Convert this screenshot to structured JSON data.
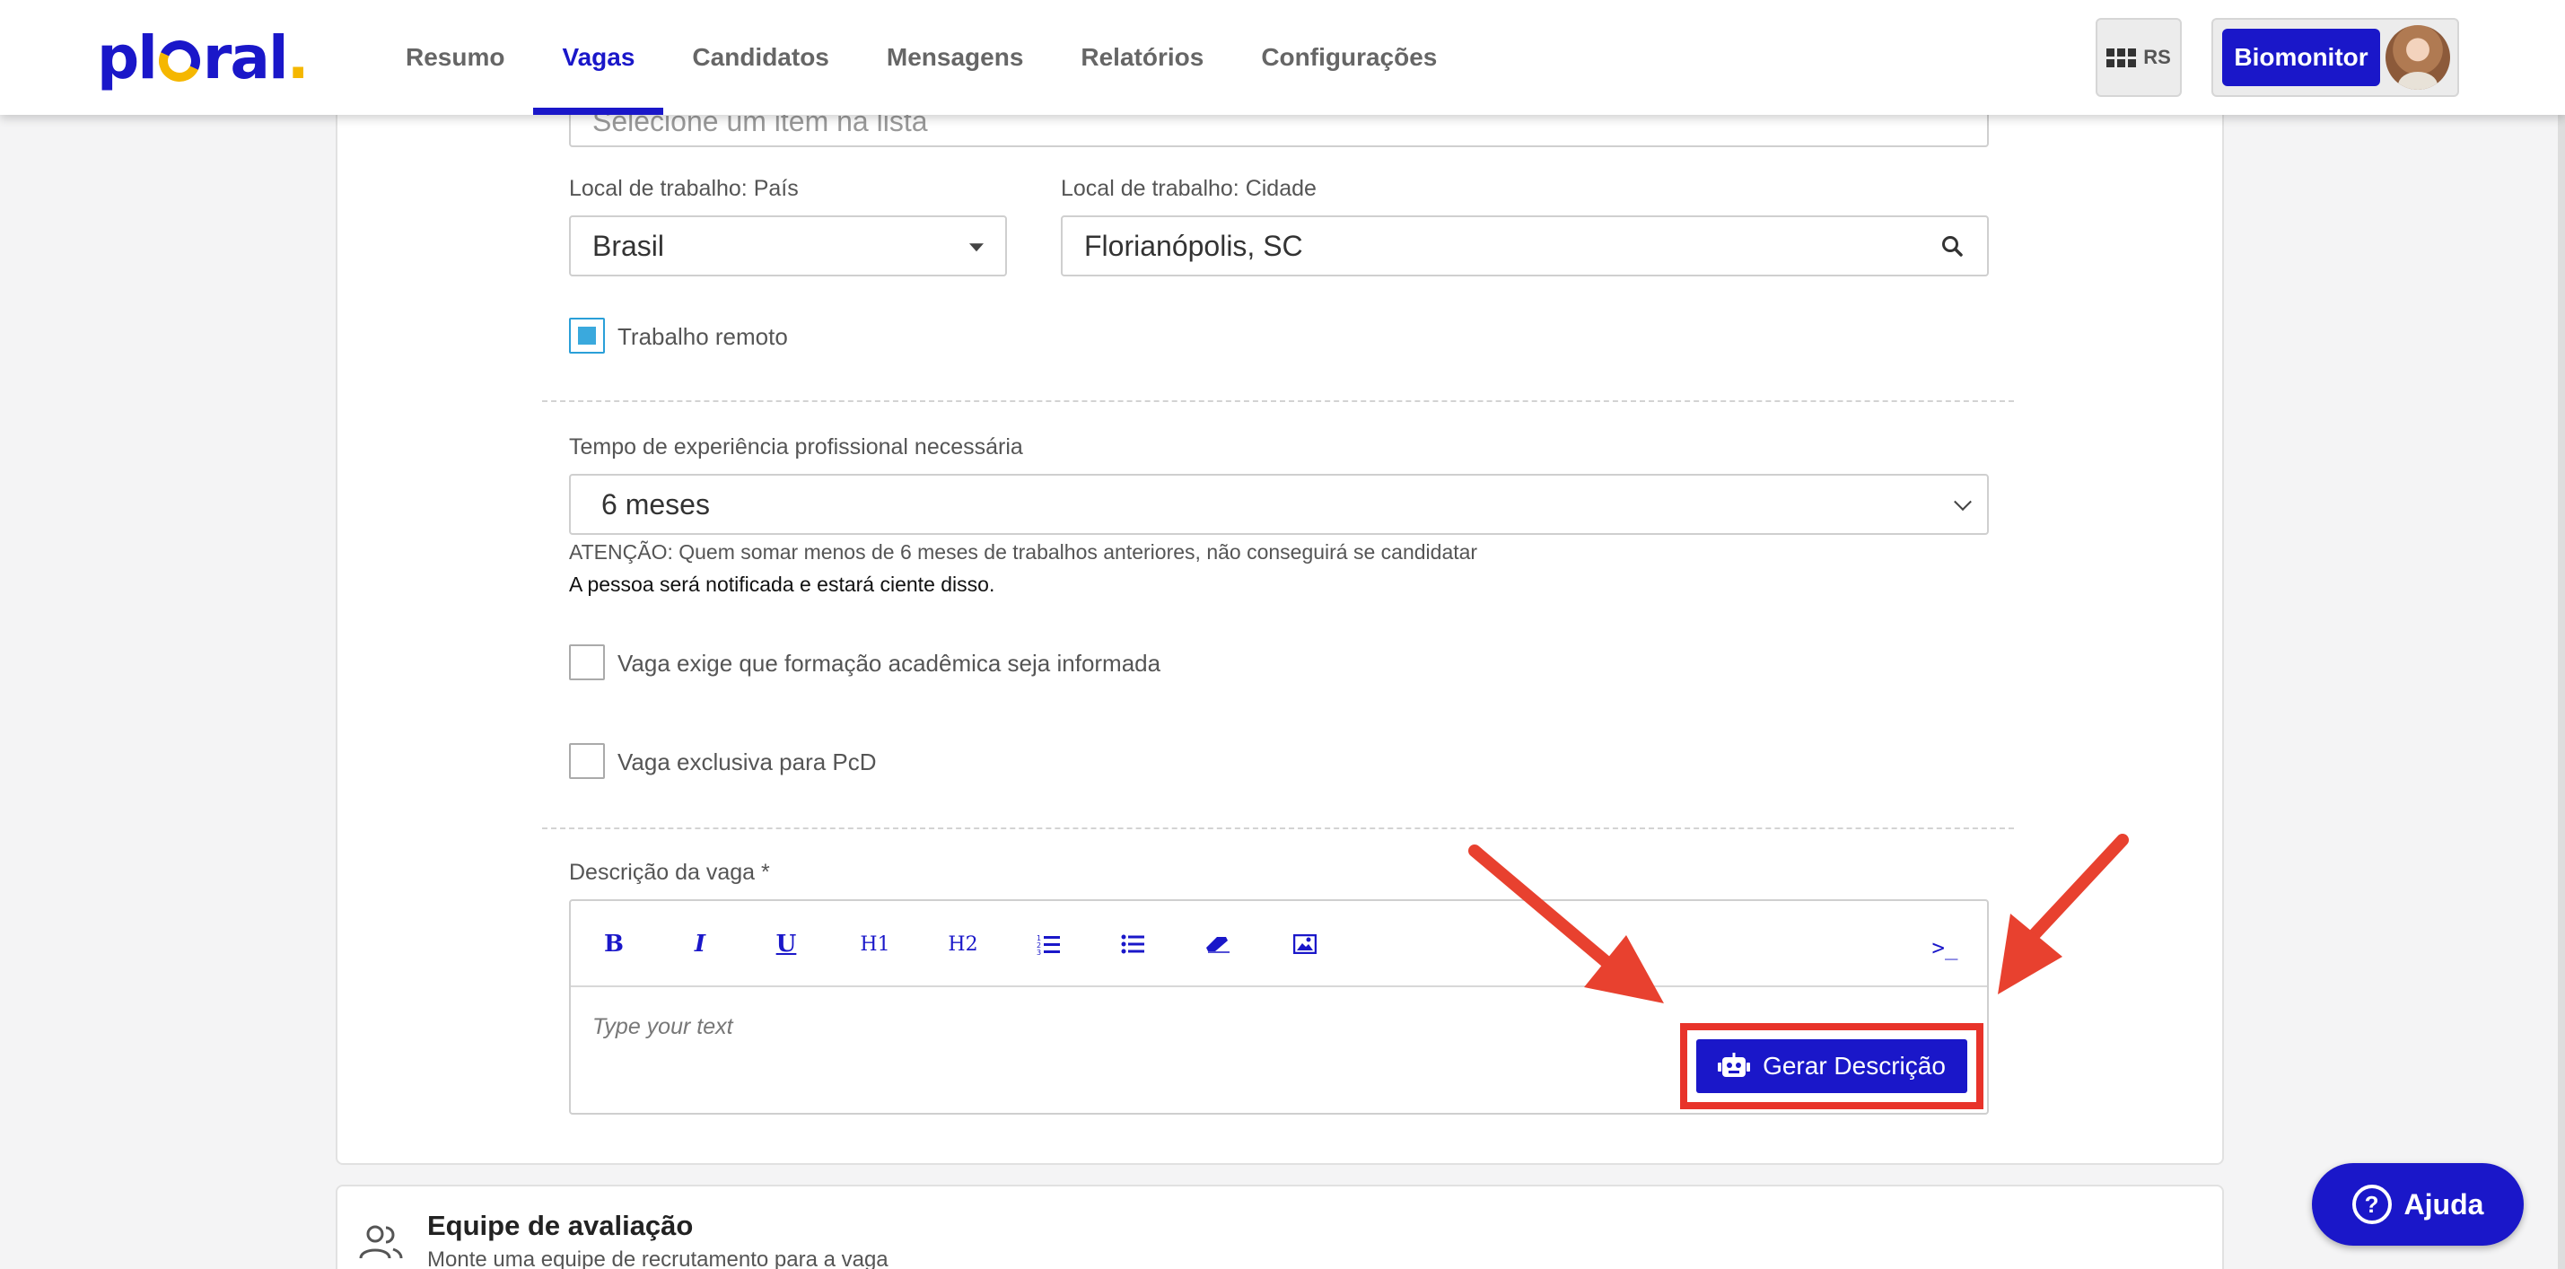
{
  "header": {
    "logo_text": "plural",
    "tabs": [
      {
        "label": "Resumo",
        "active": false
      },
      {
        "label": "Vagas",
        "active": true
      },
      {
        "label": "Candidatos",
        "active": false
      },
      {
        "label": "Mensagens",
        "active": false
      },
      {
        "label": "Relatórios",
        "active": false
      },
      {
        "label": "Configurações",
        "active": false
      }
    ],
    "apps_label": "RS",
    "company": "Biomonitor"
  },
  "form": {
    "top_select_placeholder": "Selecione um item na lista",
    "country_label": "Local de trabalho: País",
    "country_value": "Brasil",
    "city_label": "Local de trabalho: Cidade",
    "city_value": "Florianópolis, SC",
    "remote_label": "Trabalho remoto",
    "remote_checked": true,
    "experience_label": "Tempo de experiência profissional necessária",
    "experience_value": "6 meses",
    "warning": "ATENÇÃO: Quem somar menos de 6 meses de trabalhos anteriores, não conseguirá se candidatar",
    "notice": "A pessoa será notificada e estará ciente disso.",
    "academic_label": "Vaga exige que formação acadêmica seja informada",
    "academic_checked": false,
    "pcd_label": "Vaga exclusiva para PcD",
    "pcd_checked": false,
    "description_label": "Descrição da vaga *",
    "editor_placeholder": "Type your text",
    "toolbar": {
      "bold": "B",
      "italic": "I",
      "underline": "U",
      "h1": "H1",
      "h2": "H2",
      "source": ">_"
    },
    "generate_button": "Gerar Descrição"
  },
  "section2": {
    "title": "Equipe de avaliação",
    "subtitle": "Monte uma equipe de recrutamento para a vaga"
  },
  "help_button": "Ajuda",
  "colors": {
    "brand": "#1a17c9",
    "accent": "#f5b700",
    "annotation_red": "#e8332a",
    "checkbox_blue": "#3aa9dd"
  }
}
